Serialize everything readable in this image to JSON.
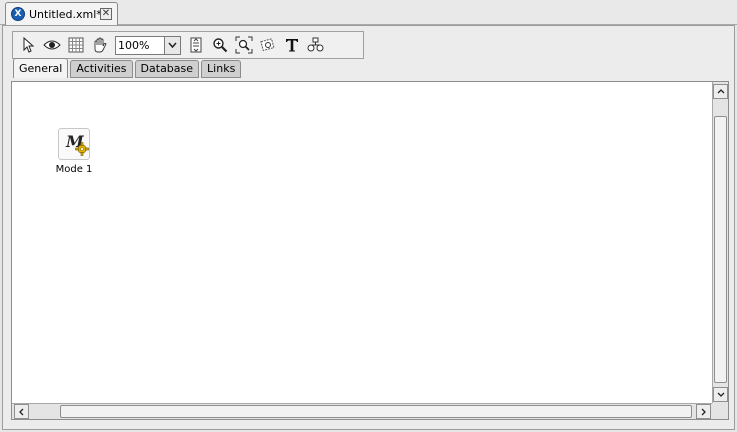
{
  "document_tab": {
    "title": "Untitled.xml*",
    "icon": "xml-file-icon",
    "close_glyph": "✕"
  },
  "toolbar": {
    "tools": [
      "select-pointer-icon",
      "preview-eye-icon",
      "grid-icon",
      "pan-hand-icon"
    ],
    "zoom": {
      "value": "100%"
    },
    "tools_right": [
      "fit-page-icon",
      "zoom-in-icon",
      "zoom-region-icon",
      "zoom-area-icon",
      "text-tool-icon",
      "align-icon"
    ]
  },
  "palette_tabs": [
    {
      "label": "General",
      "active": true
    },
    {
      "label": "Activities",
      "active": false
    },
    {
      "label": "Database",
      "active": false
    },
    {
      "label": "Links",
      "active": false
    }
  ],
  "canvas": {
    "nodes": [
      {
        "label": "Mode 1",
        "letter": "M",
        "icon": "mode-gear-icon"
      }
    ]
  }
}
